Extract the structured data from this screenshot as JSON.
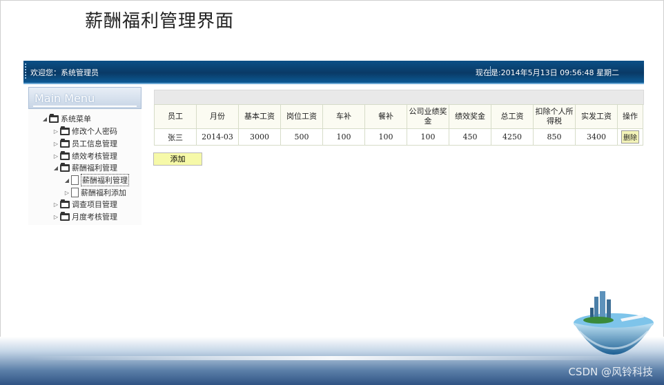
{
  "page_title": "薪酬福利管理界面",
  "topbar": {
    "welcome": "欢迎您：系统管理员",
    "now": "现在是:2014年5月13日  09:56:48 星期二"
  },
  "sidebar": {
    "header": "Main Menu",
    "root": "系统菜单",
    "items": [
      {
        "label": "修改个人密码"
      },
      {
        "label": "员工信息管理"
      },
      {
        "label": "绩效考核管理"
      },
      {
        "label": "薪酬福利管理"
      },
      {
        "label": "薪酬福利管理"
      },
      {
        "label": "薪酬福利添加"
      },
      {
        "label": "调查项目管理"
      },
      {
        "label": "月度考核管理"
      }
    ]
  },
  "table": {
    "headers": [
      "员工",
      "月份",
      "基本工资",
      "岗位工资",
      "车补",
      "餐补",
      "公司业绩奖金",
      "绩效奖金",
      "总工资",
      "扣除个人所得税",
      "实发工资",
      "操作"
    ],
    "rows": [
      [
        "张三",
        "2014-03",
        "3000",
        "500",
        "100",
        "100",
        "100",
        "450",
        "4250",
        "850",
        "3400"
      ]
    ],
    "delete_label": "删除"
  },
  "add_label": "添加",
  "watermark": "CSDN @风铃科技"
}
